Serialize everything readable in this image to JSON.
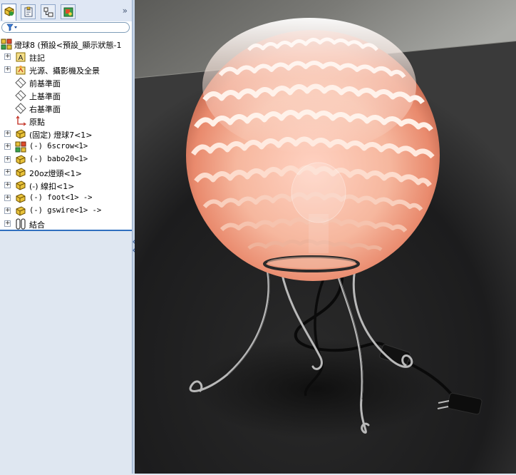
{
  "feature_tree": {
    "root": {
      "label": "燈球8 (預設<預設_顯示狀態-1"
    },
    "items": [
      {
        "label": "註記",
        "icon": "annotations-icon",
        "expandable": true
      },
      {
        "label": "光源、攝影機及全景",
        "icon": "lights-cameras-icon",
        "expandable": true
      },
      {
        "label": "前基準面",
        "icon": "plane-icon",
        "expandable": false
      },
      {
        "label": "上基準面",
        "icon": "plane-icon",
        "expandable": false
      },
      {
        "label": "右基準面",
        "icon": "plane-icon",
        "expandable": false
      },
      {
        "label": "原點",
        "icon": "origin-icon",
        "expandable": false
      },
      {
        "label": "(固定) 燈球7<1>",
        "icon": "part-icon",
        "expandable": true
      },
      {
        "label": "(-) 6scrow<1>",
        "icon": "assembly-icon",
        "expandable": true
      },
      {
        "label": "(-) babo20<1>",
        "icon": "part-icon",
        "expandable": true
      },
      {
        "label": "20oz燈頭<1>",
        "icon": "part-icon",
        "expandable": true
      },
      {
        "label": "(-) 線扣<1>",
        "icon": "part-icon",
        "expandable": true
      },
      {
        "label": "(-) foot<1> ->",
        "icon": "part-icon",
        "expandable": true
      },
      {
        "label": "(-) gswire<1> ->",
        "icon": "part-icon",
        "expandable": true
      },
      {
        "label": "結合",
        "icon": "mates-icon",
        "expandable": true
      }
    ]
  },
  "tabs": [
    {
      "name": "featuremanager-tab"
    },
    {
      "name": "propertymanager-tab"
    },
    {
      "name": "configurationmanager-tab"
    },
    {
      "name": "displaymanager-tab"
    }
  ],
  "colors": {
    "panel": "#ffffff",
    "panel_bottom": "#dfe7f1",
    "accent": "#2f6fbf",
    "lamp_glow": "#f7b79e",
    "floor": "#1f1f20"
  }
}
